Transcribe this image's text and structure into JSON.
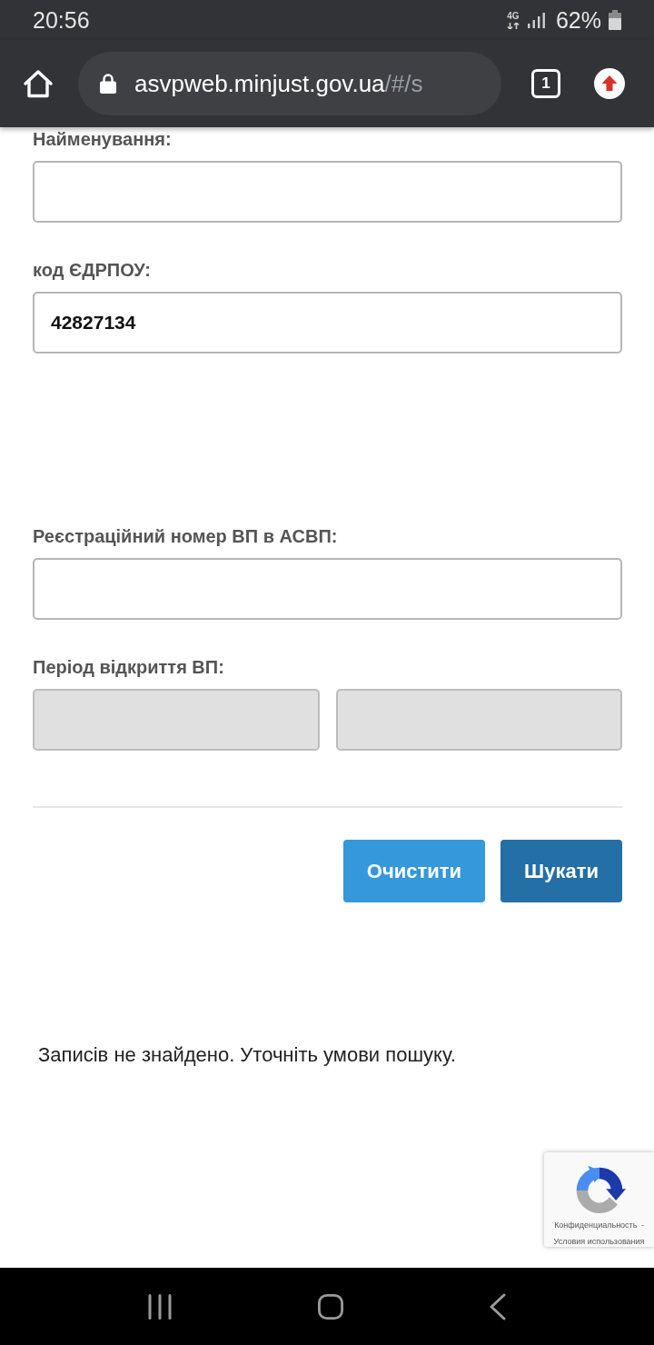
{
  "status_bar": {
    "time": "20:56",
    "network": "4G",
    "battery": "62%"
  },
  "browser_bar": {
    "url_host": "asvpweb.minjust.gov.ua",
    "url_path": "/#/s",
    "tab_count": "1"
  },
  "form": {
    "groups": [
      {
        "fields": [
          {
            "kind": "text",
            "label": "Найменування:",
            "disabled": false
          },
          {
            "kind": "text",
            "label": "код ЄДРПОУ:",
            "value": "42827134",
            "disabled": false
          }
        ]
      },
      {
        "fields": [
          {
            "kind": "text",
            "label": "Реєстраційний номер ВП в АСВП:",
            "disabled": false
          },
          {
            "kind": "range",
            "label": "Період відкриття ВП:",
            "inputs": [
              {
                "disabled": true
              },
              {
                "disabled": true
              }
            ]
          }
        ]
      }
    ],
    "buttons": [
      {
        "kind": "secondary",
        "label": "Очистити"
      },
      {
        "kind": "primary",
        "label": "Шукати"
      }
    ]
  },
  "message": "Записів не знайдено. Уточніть умови пошуку.",
  "captcha": {
    "privacy_link": "Конфиденциальность",
    "separator": "-",
    "terms_link": "Условия использования"
  }
}
